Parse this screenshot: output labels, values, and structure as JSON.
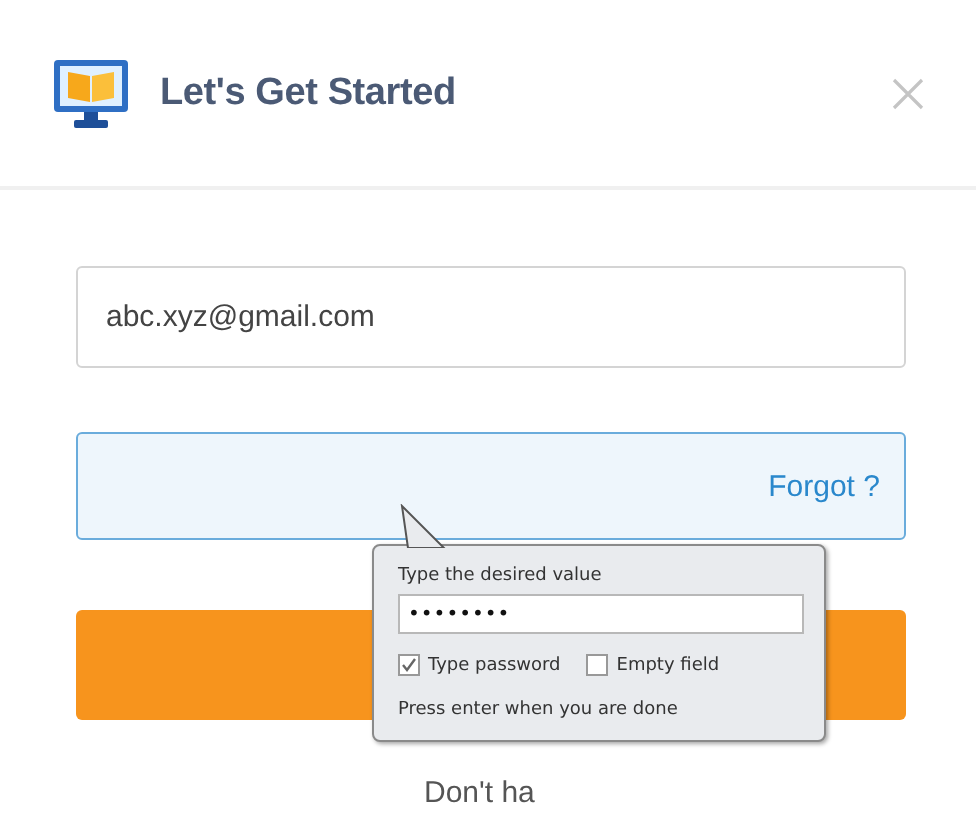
{
  "header": {
    "title": "Let's Get Started"
  },
  "email_field": {
    "value": "abc.xyz@gmail.com"
  },
  "password_field": {
    "focused": true,
    "link": "Forgot ?"
  },
  "footer": {
    "text": "Don't ha"
  },
  "popup": {
    "label": "Type the desired value",
    "value": "••••••••",
    "checkboxes": [
      {
        "label": "Type password",
        "checked": true
      },
      {
        "label": "Empty field",
        "checked": false
      }
    ],
    "hint": "Press enter when you are done"
  }
}
